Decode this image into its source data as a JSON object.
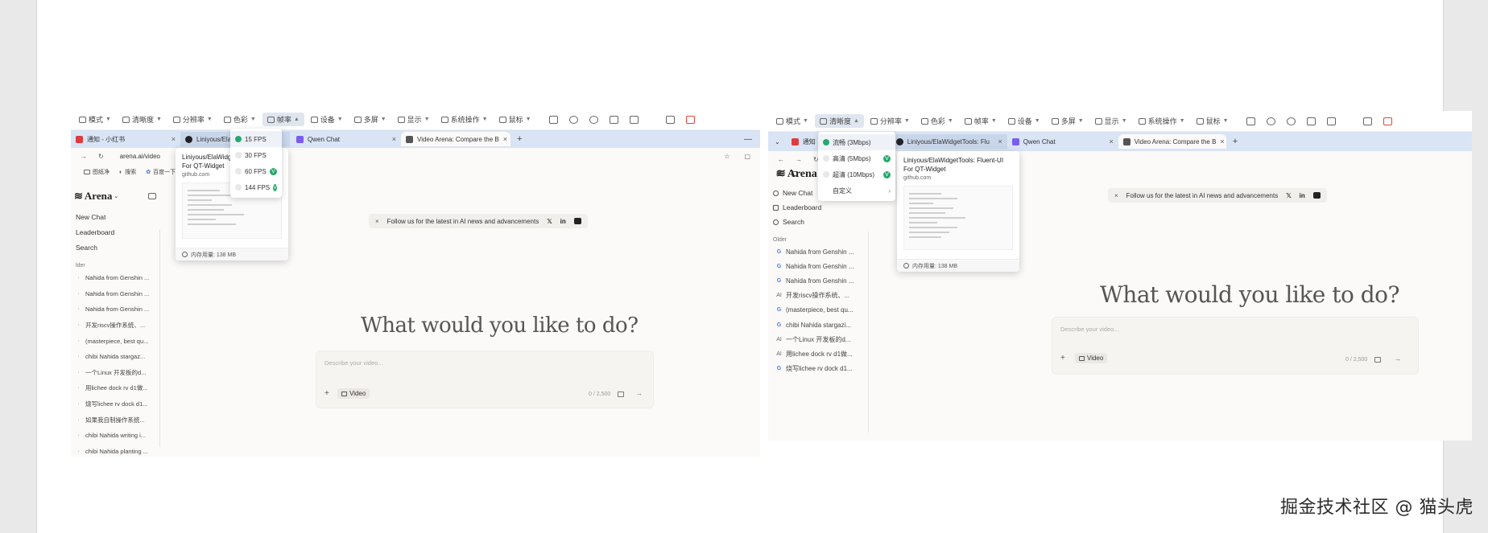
{
  "watermark": "掘金技术社区 @ 猫头虎",
  "left": {
    "toolbar": {
      "items": [
        "模式",
        "清晰度",
        "分辨率",
        "色彩",
        "帧率",
        "设备",
        "多屏",
        "显示",
        "系统操作",
        "鼠标"
      ],
      "active_item": "帧率"
    },
    "tabs": [
      "通知 - 小红书",
      "Liniyous/ElaW",
      "Qwen Chat",
      "Video Arena: Compare the B"
    ],
    "address": "arena.ai/video",
    "bookmarks": [
      "图纸净",
      "搜索",
      "百度一下"
    ],
    "fps_menu": {
      "options": [
        "15 FPS",
        "30 FPS",
        "60 FPS",
        "144 FPS"
      ],
      "selected": "15 FPS",
      "badged": [
        "60 FPS",
        "144 FPS"
      ]
    },
    "tab_preview": {
      "title": "Liniyous/ElaWidget\nFor QT-Widget",
      "url": "github.com",
      "memory": "内存用量: 138 MB"
    },
    "sidebar": {
      "logo": "Arena",
      "nav": [
        "New Chat",
        "Leaderboard",
        "Search"
      ],
      "older_label": "lder",
      "history": [
        "Nahida from Genshin ...",
        "Nahida from Genshin ...",
        "Nahida from Genshin ...",
        "开发riscv操作系统、...",
        "(masterpiece, best qu...",
        "chibi Nahida stargaz...",
        "一个Linux 开发板的d...",
        "用lichee dock rv d1做...",
        "烧写lichee rv dock d1...",
        "如果我自制操作系统...",
        "chibi Nahida writing i...",
        "chibi Nahida planting ..."
      ]
    },
    "banner": {
      "text": "Follow us for the latest in AI news and advancements",
      "close": "×"
    },
    "hero": "What would you like to do?",
    "composer": {
      "placeholder": "Describe your video...",
      "mode": "Video",
      "count": "0 / 2,500"
    }
  },
  "right": {
    "toolbar": {
      "items": [
        "模式",
        "清晰度",
        "分辨率",
        "色彩",
        "帧率",
        "设备",
        "多屏",
        "显示",
        "系统操作",
        "鼠标"
      ],
      "active_item": "清晰度"
    },
    "tabs": [
      "通知",
      "Liniyous/ElaWidgetTools: Flu",
      "Qwen Chat",
      "Video Arena: Compare the B"
    ],
    "quality_menu": {
      "options": [
        "流畅 (3Mbps)",
        "高清 (5Mbps)",
        "超清 (10Mbps)",
        "自定义"
      ],
      "selected": "流畅 (3Mbps)",
      "badged": [
        "高清 (5Mbps)",
        "超清 (10Mbps)"
      ]
    },
    "tab_preview": {
      "title": "Liniyous/ElaWidgetTools: Fluent-UI\nFor QT-Widget",
      "url": "github.com",
      "memory": "内存用量: 138 MB"
    },
    "sidebar": {
      "logo": "Arena",
      "nav": [
        "New Chat",
        "Leaderboard",
        "Search"
      ],
      "older_label": "Older",
      "history": [
        "Nahida from Genshin ...",
        "Nahida from Genshin ...",
        "Nahida from Genshin ...",
        "开发riscv操作系统、...",
        "(masterpiece, best qu...",
        "chibi Nahida stargazi...",
        "一个Linux 开发板的d...",
        "用lichee dock rv d1做...",
        "烧写lichee rv dock d1..."
      ],
      "history_icons": [
        "G",
        "G",
        "G",
        "AI",
        "G",
        "G",
        "AI",
        "AI",
        "G"
      ]
    },
    "banner": {
      "text": "Follow us for the latest in AI news and advancements",
      "close": "×"
    },
    "hero": "What would you like to do?",
    "composer": {
      "placeholder": "Describe your video...",
      "mode": "Video",
      "count": "0 / 2,500"
    }
  },
  "colors": {
    "tabstrip": "#d9e4f5",
    "check_green": "#26a96c",
    "link_red": "#e0453a"
  }
}
